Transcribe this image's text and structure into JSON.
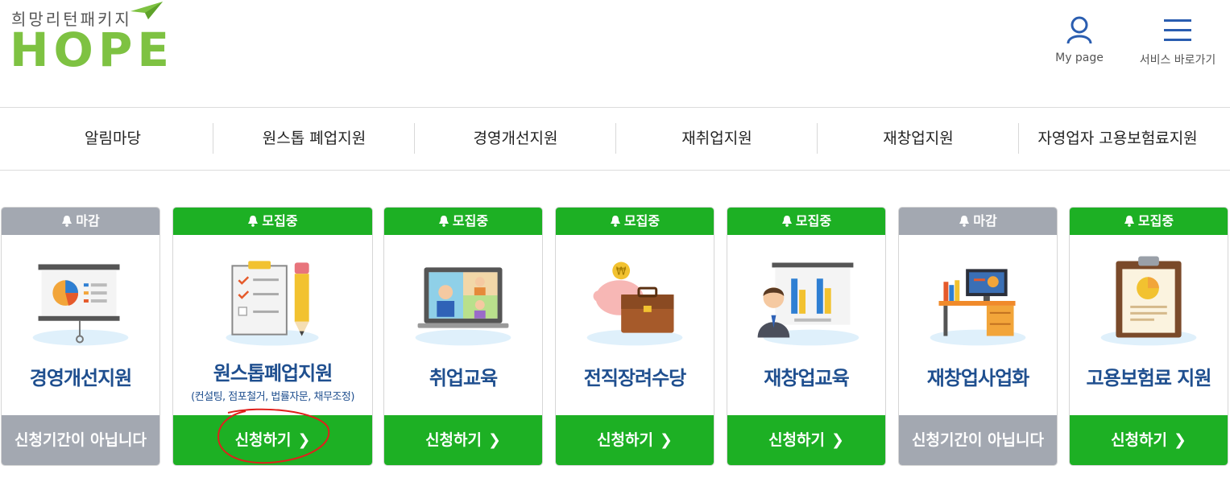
{
  "logo": {
    "korean": "희망리턴패키지",
    "hope": "HOPE"
  },
  "header": {
    "mypage_label": "My page",
    "service_label": "서비스 바로가기"
  },
  "nav": [
    {
      "label": "알림마당"
    },
    {
      "label": "원스톱 폐업지원"
    },
    {
      "label": "경영개선지원"
    },
    {
      "label": "재취업지원"
    },
    {
      "label": "재창업지원"
    },
    {
      "label": "자영업자 고용보험료지원"
    }
  ],
  "cards": [
    {
      "status": "마감",
      "title": "경영개선지원",
      "sub": "",
      "action": "신청기간이 아닙니다",
      "icon": "presentation-board-icon"
    },
    {
      "status": "모집중",
      "title": "원스톱폐업지원",
      "sub": "(컨설팅, 점포철거, 법률자문, 채무조정)",
      "action": "신청하기",
      "icon": "checklist-clipboard-icon"
    },
    {
      "status": "모집중",
      "title": "취업교육",
      "sub": "",
      "action": "신청하기",
      "icon": "video-conference-laptop-icon"
    },
    {
      "status": "모집중",
      "title": "전직장려수당",
      "sub": "",
      "action": "신청하기",
      "icon": "piggybank-briefcase-icon"
    },
    {
      "status": "모집중",
      "title": "재창업교육",
      "sub": "",
      "action": "신청하기",
      "icon": "presenter-chart-icon"
    },
    {
      "status": "마감",
      "title": "재창업사업화",
      "sub": "",
      "action": "신청기간이 아닙니다",
      "icon": "office-desk-icon"
    },
    {
      "status": "모집중",
      "title": "고용보험료 지원",
      "sub": "",
      "action": "신청하기",
      "icon": "report-clipboard-icon"
    }
  ],
  "colors": {
    "open": "#1db024",
    "closed": "#a3a8b1",
    "title": "#1f4f8f",
    "logo_green": "#7ec242",
    "annotation": "#e0201c"
  }
}
